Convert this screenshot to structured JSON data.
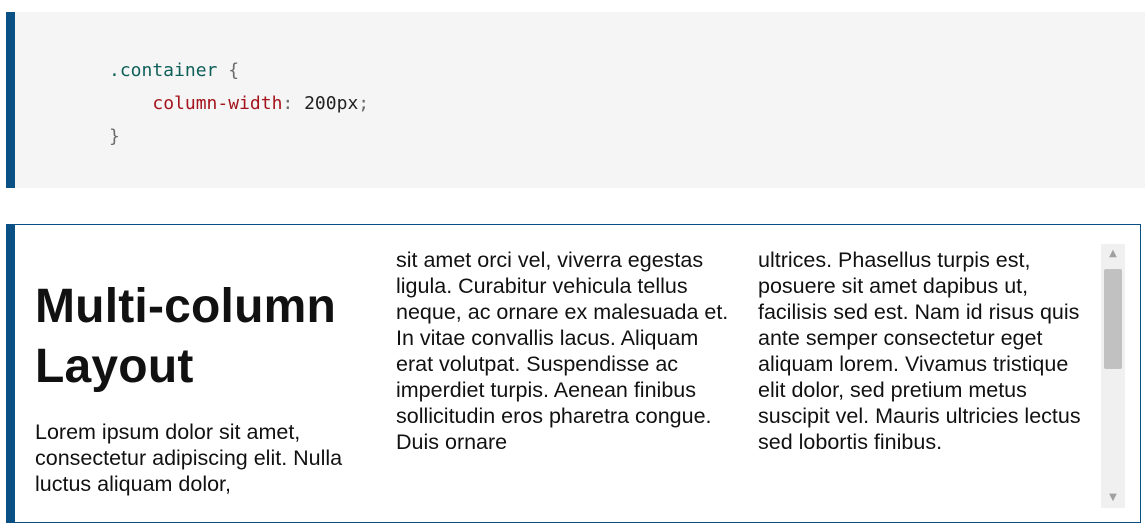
{
  "code": {
    "selector": ".container",
    "open_brace": "{",
    "property": "column-width",
    "colon": ":",
    "value": "200px",
    "semicolon": ";",
    "close_brace": "}"
  },
  "demo": {
    "heading_line1": "Multi-column",
    "heading_line2": "Layout",
    "col1_text": "Lorem ipsum dolor sit amet, consectetur adipiscing elit. Nulla luctus aliquam dolor,",
    "col2_text": "sit amet orci vel, viverra egestas ligula. Curabitur vehicula tellus neque, ac ornare ex malesuada et. In vitae convallis lacus. Aliquam erat volutpat. Suspendisse ac imperdiet turpis. Aenean finibus sollicitudin eros pharetra congue. Duis ornare",
    "col3_text": "ultrices. Phasellus turpis est, posuere sit amet dapibus ut, facilisis sed est. Nam id risus quis ante semper consectetur eget aliquam lorem. Vivamus tristique elit dolor, sed pretium metus suscipit vel. Mauris ultricies lectus sed lobortis finibus."
  },
  "scrollbar": {
    "up_icon": "triangle-up-icon",
    "down_icon": "triangle-down-icon"
  }
}
